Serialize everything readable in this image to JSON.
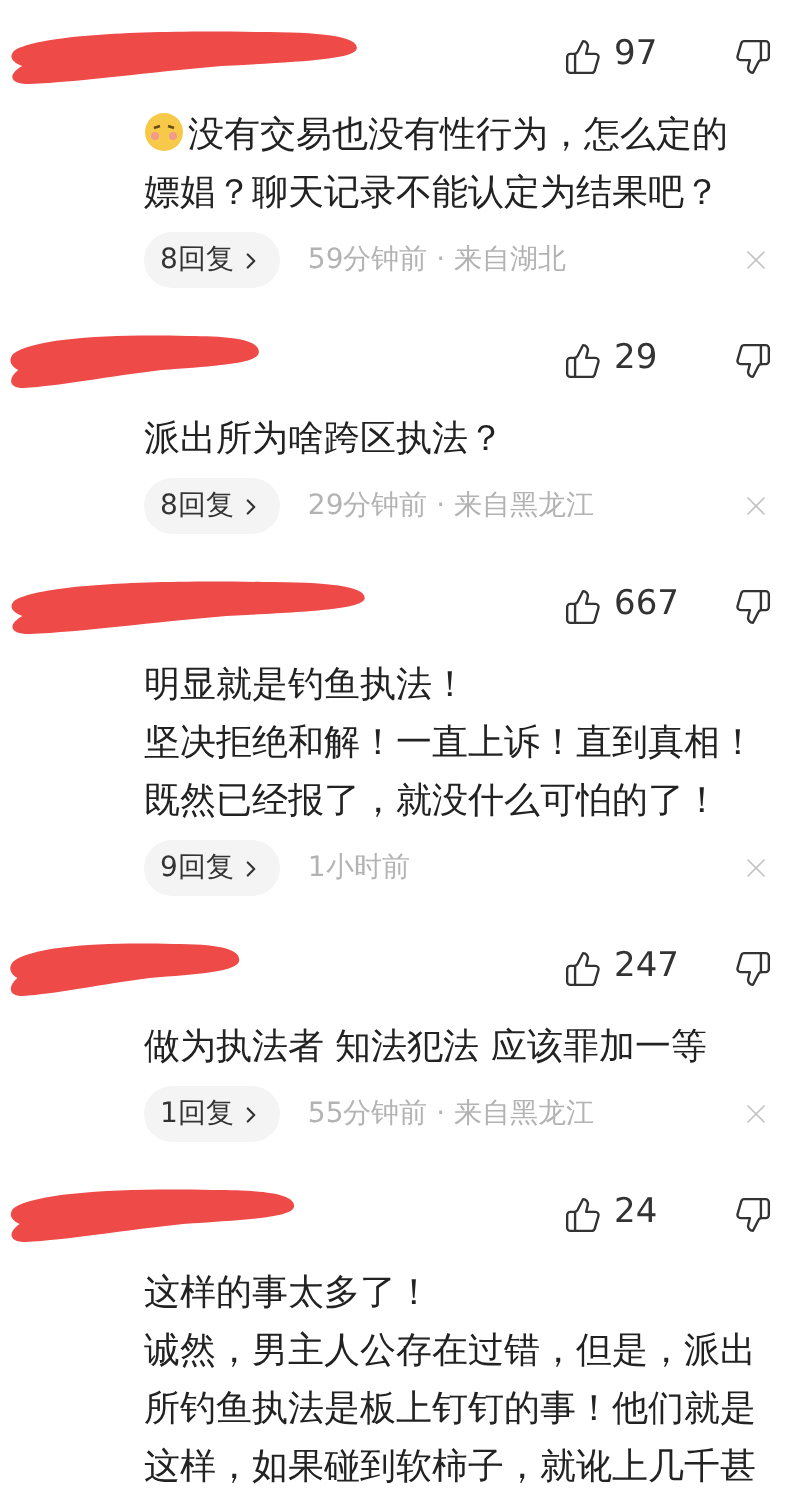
{
  "comments": [
    {
      "likes": "97",
      "emoji": true,
      "lines": [
        "没有交易也没有性行为，怎么定的",
        "嫖娼？聊天记录不能认定为结果吧？"
      ],
      "replies": "8回复",
      "meta": "59分钟前 · 来自湖北"
    },
    {
      "likes": "29",
      "emoji": false,
      "lines": [
        "派出所为啥跨区执法？"
      ],
      "replies": "8回复",
      "meta": "29分钟前 · 来自黑龙江"
    },
    {
      "likes": "667",
      "emoji": false,
      "lines": [
        "明显就是钓鱼执法！",
        "坚决拒绝和解！一直上诉！直到真相！",
        "既然已经报了，就没什么可怕的了！"
      ],
      "replies": "9回复",
      "meta": "1小时前"
    },
    {
      "likes": "247",
      "emoji": false,
      "lines": [
        "做为执法者 知法犯法 应该罪加一等"
      ],
      "replies": "1回复",
      "meta": "55分钟前 · 来自黑龙江"
    },
    {
      "likes": "24",
      "emoji": false,
      "lines": [
        "这样的事太多了！",
        "诚然，男主人公存在过错，但是，派出",
        "所钓鱼执法是板上钉钉的事！他们就是",
        "这样，如果碰到软柿子，就讹上几千甚"
      ]
    }
  ]
}
